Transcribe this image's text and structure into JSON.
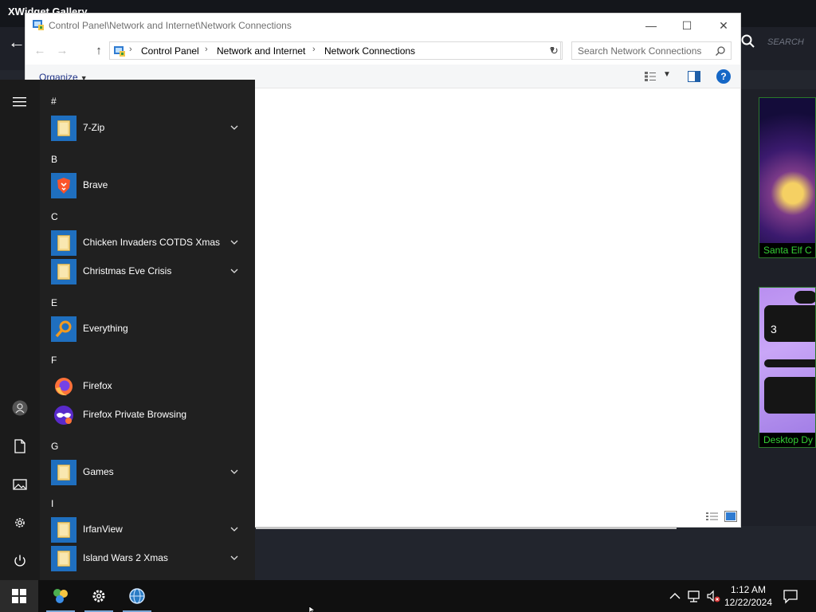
{
  "background_app": {
    "title": "XWidget Gallery",
    "search_placeholder": "SEARCH",
    "thumbnails": [
      {
        "caption": "Santa Elf C"
      },
      {
        "caption": "Desktop Dy",
        "widget_number": "3"
      }
    ]
  },
  "explorer": {
    "title": "Control Panel\\Network and Internet\\Network Connections",
    "breadcrumb": [
      "Control Panel",
      "Network and Internet",
      "Network Connections"
    ],
    "search_placeholder": "Search Network Connections",
    "organize_label": "Organize",
    "help_label": "?"
  },
  "start_menu": {
    "groups": [
      {
        "letter": "#",
        "apps": [
          {
            "label": "7-Zip",
            "icon": "folder-icon",
            "expandable": true
          }
        ]
      },
      {
        "letter": "B",
        "apps": [
          {
            "label": "Brave",
            "icon": "brave-icon",
            "expandable": false
          }
        ]
      },
      {
        "letter": "C",
        "apps": [
          {
            "label": "Chicken Invaders COTDS Xmas",
            "icon": "folder-icon",
            "expandable": true
          },
          {
            "label": "Christmas Eve Crisis",
            "icon": "folder-icon",
            "expandable": true
          }
        ]
      },
      {
        "letter": "E",
        "apps": [
          {
            "label": "Everything",
            "icon": "everything-icon",
            "expandable": false
          }
        ]
      },
      {
        "letter": "F",
        "apps": [
          {
            "label": "Firefox",
            "icon": "firefox-icon",
            "expandable": false
          },
          {
            "label": "Firefox Private Browsing",
            "icon": "firefox-private-icon",
            "expandable": false
          }
        ]
      },
      {
        "letter": "G",
        "apps": [
          {
            "label": "Games",
            "icon": "folder-icon",
            "expandable": true
          }
        ]
      },
      {
        "letter": "I",
        "apps": [
          {
            "label": "IrfanView",
            "icon": "folder-icon",
            "expandable": true
          },
          {
            "label": "Island Wars 2 Xmas",
            "icon": "folder-icon",
            "expandable": true
          }
        ]
      }
    ],
    "rail_icons": [
      "hamburger-icon",
      "user-icon",
      "documents-icon",
      "pictures-icon",
      "settings-icon",
      "power-icon"
    ]
  },
  "taskbar": {
    "pinned": [
      "xwidget-icon",
      "settings-icon",
      "globe-icon"
    ],
    "tray_icons": [
      "chevron-up-icon",
      "network-icon",
      "volume-muted-icon"
    ],
    "time": "1:12 AM",
    "date": "12/22/2024"
  },
  "colors": {
    "accent": "#1f6fbf",
    "start_bg": "#202020",
    "taskbar_bg": "#101010",
    "thumb_caption": "#35d135"
  }
}
